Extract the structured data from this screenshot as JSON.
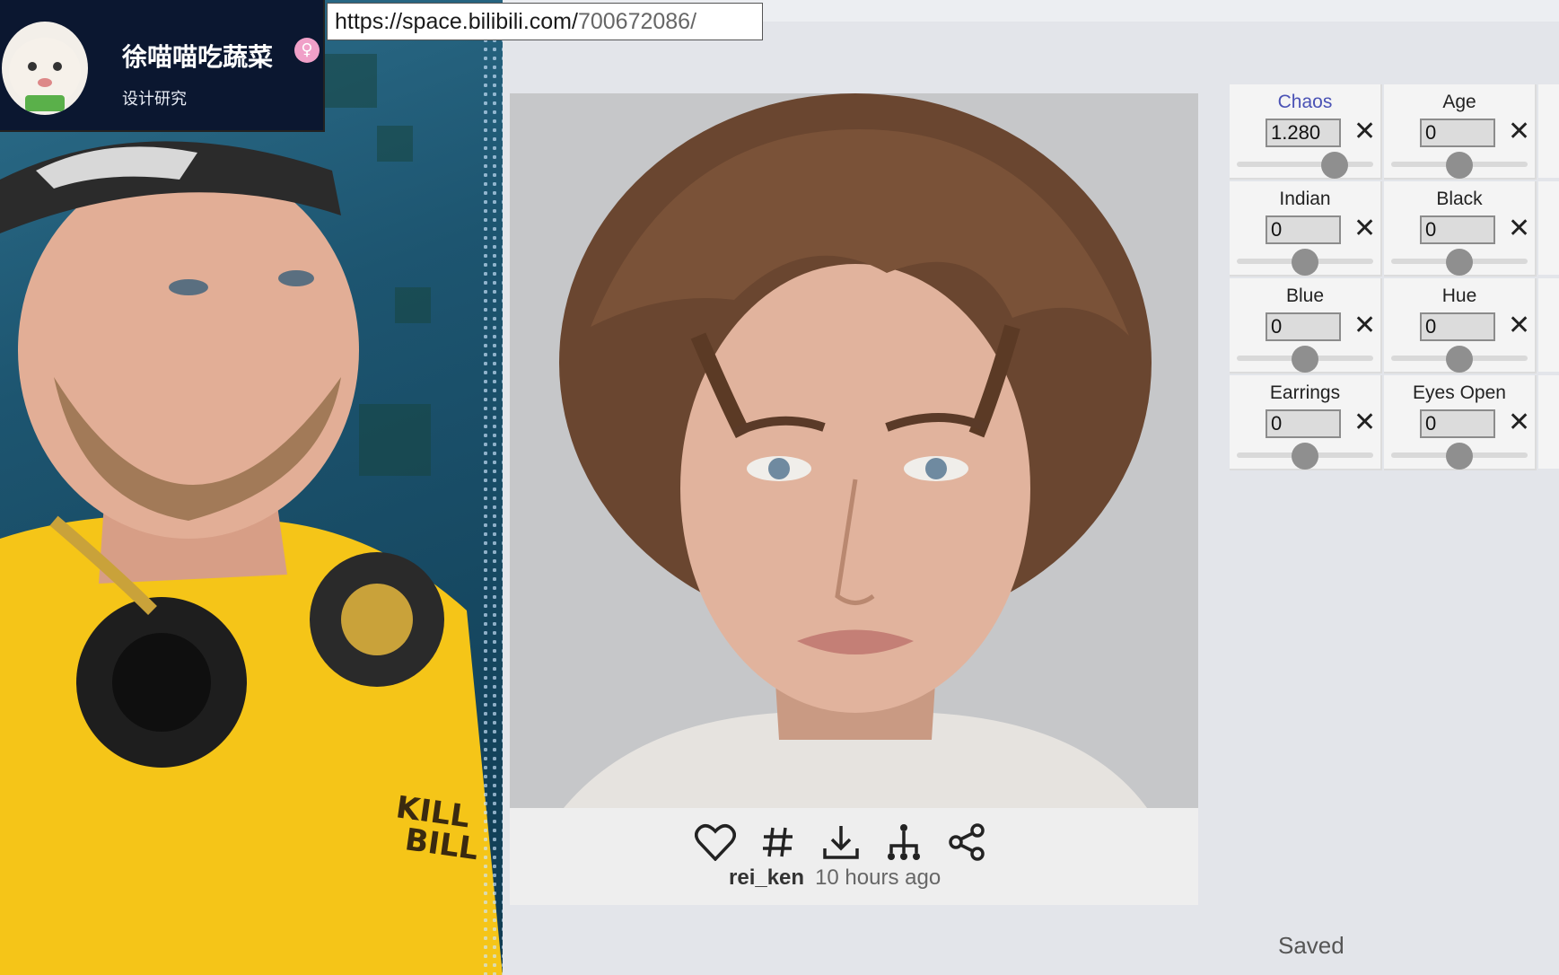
{
  "browser": {
    "url_domain": "https://space.bilibili.com/",
    "url_path": "700672086/"
  },
  "channel": {
    "name": "徐喵喵吃蔬菜",
    "subtitle": "设计研究",
    "gender_glyph": "♀"
  },
  "card": {
    "author": "rei_ken",
    "time": "10 hours ago",
    "actions": [
      {
        "icon": "heart-icon"
      },
      {
        "icon": "hashtag-icon"
      },
      {
        "icon": "download-icon"
      },
      {
        "icon": "branch-icon"
      },
      {
        "icon": "share-icon"
      }
    ]
  },
  "controls": [
    {
      "label": "Chaos",
      "value": "1.280",
      "slider": 0.72,
      "active": true
    },
    {
      "label": "Age",
      "value": "0",
      "slider": 0.5
    },
    {
      "label": "Indian",
      "value": "0",
      "slider": 0.5
    },
    {
      "label": "Black",
      "value": "0",
      "slider": 0.5
    },
    {
      "label": "Blue",
      "value": "0",
      "slider": 0.5
    },
    {
      "label": "Hue",
      "value": "0",
      "slider": 0.5
    },
    {
      "label": "Earrings",
      "value": "0",
      "slider": 0.5
    },
    {
      "label": "Eyes Open",
      "value": "0",
      "slider": 0.5
    }
  ],
  "clear_glyph": "✕",
  "status": "Saved",
  "colors": {
    "accent": "#4a52b5",
    "shirt": "#f5c518"
  }
}
